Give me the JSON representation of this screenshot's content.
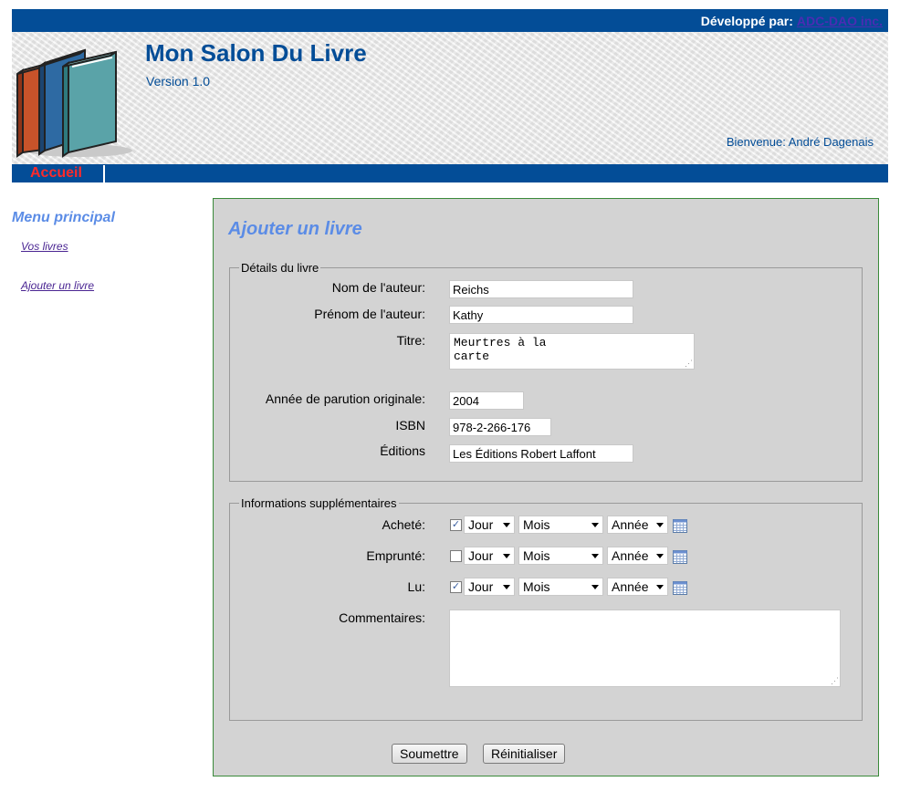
{
  "topbar": {
    "developed_by_label": "Développé par:",
    "developer_link": "ADC-DAO inc."
  },
  "header": {
    "app_title": "Mon Salon Du Livre",
    "version": "Version 1.0",
    "welcome": "Bienvenue: André Dagenais",
    "logo_icon": "stack-of-books-icon"
  },
  "nav": {
    "home": "Accueil"
  },
  "sidebar": {
    "title": "Menu principal",
    "items": [
      {
        "label": "Vos livres"
      },
      {
        "label": "Ajouter un livre"
      }
    ]
  },
  "form": {
    "title": "Ajouter un livre",
    "book_details": {
      "legend": "Détails du livre",
      "author_last_label": "Nom de l'auteur:",
      "author_last_value": "Reichs",
      "author_first_label": "Prénom de l'auteur:",
      "author_first_value": "Kathy",
      "title_label": "Titre:",
      "title_value": "Meurtres à la\ncarte",
      "year_label": "Année de parution originale:",
      "year_value": "2004",
      "isbn_label": "ISBN",
      "isbn_value": "978-2-266-176",
      "publisher_label": "Éditions",
      "publisher_value": "Les Éditions Robert Laffont"
    },
    "extra_info": {
      "legend": "Informations supplémentaires",
      "rows": [
        {
          "label": "Acheté:",
          "checked": true,
          "day": "Jour",
          "month": "Mois",
          "year": "Année"
        },
        {
          "label": "Emprunté:",
          "checked": false,
          "day": "Jour",
          "month": "Mois",
          "year": "Année"
        },
        {
          "label": "Lu:",
          "checked": true,
          "day": "Jour",
          "month": "Mois",
          "year": "Année"
        }
      ],
      "comments_label": "Commentaires:",
      "comments_value": ""
    },
    "submit_label": "Soumettre",
    "reset_label": "Réinitialiser"
  },
  "colors": {
    "brand_blue": "#034d97",
    "menu_title": "#5b8ce6",
    "home_link": "#ff2a2a",
    "panel_bg": "#d3d3d3",
    "panel_border": "#3a8a3a"
  }
}
